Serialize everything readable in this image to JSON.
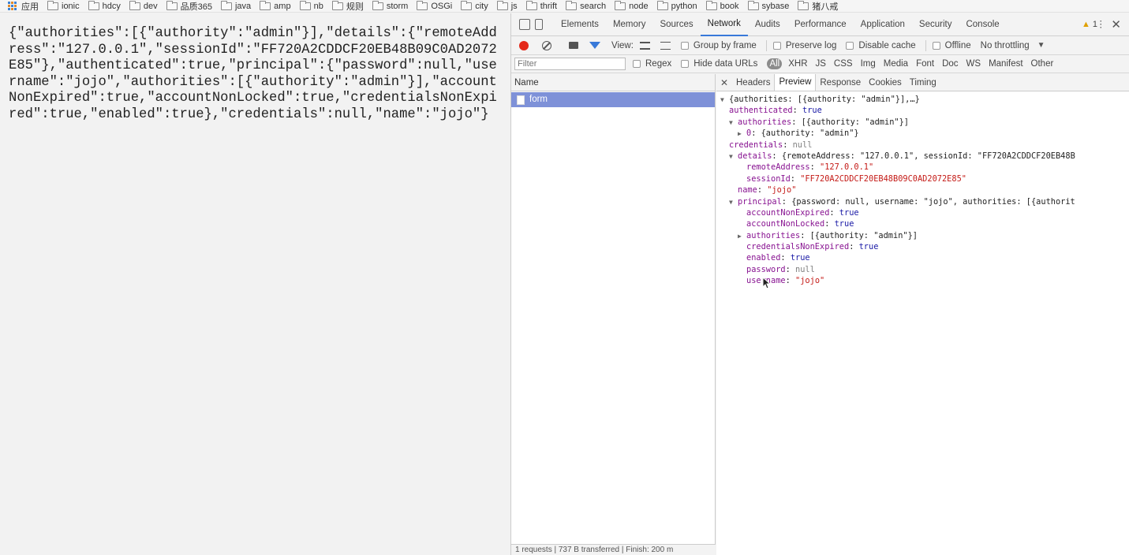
{
  "bookmarks": {
    "apps_label": "应用",
    "folders": [
      "ionic",
      "hdcy",
      "dev",
      "品质365",
      "java",
      "amp",
      "nb",
      "规则",
      "storm",
      "OSGi",
      "city",
      "js",
      "thrift",
      "search",
      "node",
      "python",
      "book",
      "sybase",
      "猪八戒"
    ]
  },
  "page": {
    "raw_json": "{\"authorities\":[{\"authority\":\"admin\"}],\"details\":{\"remoteAddress\":\"127.0.0.1\",\"sessionId\":\"FF720A2CDDCF20EB48B09C0AD2072E85\"},\"authenticated\":true,\"principal\":{\"password\":null,\"username\":\"jojo\",\"authorities\":[{\"authority\":\"admin\"}],\"accountNonExpired\":true,\"accountNonLocked\":true,\"credentialsNonExpired\":true,\"enabled\":true},\"credentials\":null,\"name\":\"jojo\"}"
  },
  "devtools": {
    "tabs": [
      "Elements",
      "Memory",
      "Sources",
      "Network",
      "Audits",
      "Performance",
      "Application",
      "Security",
      "Console"
    ],
    "active_tab": "Network",
    "warning_count": "1",
    "toolbar": {
      "view_label": "View:",
      "group_by_frame": "Group by frame",
      "preserve_log": "Preserve log",
      "disable_cache": "Disable cache",
      "offline": "Offline",
      "throttling": "No throttling"
    },
    "filter": {
      "placeholder": "Filter",
      "regex": "Regex",
      "hide_data_urls": "Hide data URLs",
      "types": [
        "All",
        "XHR",
        "JS",
        "CSS",
        "Img",
        "Media",
        "Font",
        "Doc",
        "WS",
        "Manifest",
        "Other"
      ]
    },
    "requests": {
      "column_name": "Name",
      "rows": [
        "form"
      ],
      "status": "1 requests | 737 B transferred | Finish: 200 m"
    },
    "detail_tabs": [
      "Headers",
      "Preview",
      "Response",
      "Cookies",
      "Timing"
    ],
    "active_detail_tab": "Preview",
    "preview": {
      "root_summary": "{authorities: [{authority: \"admin\"}],…}",
      "authenticated_key": "authenticated",
      "authenticated_val": "true",
      "authorities_key": "authorities",
      "authorities_summary": "[{authority: \"admin\"}]",
      "auth0_key": "0",
      "auth0_summary": "{authority: \"admin\"}",
      "credentials_key": "credentials",
      "credentials_val": "null",
      "details_key": "details",
      "details_summary": "{remoteAddress: \"127.0.0.1\", sessionId: \"FF720A2CDDCF20EB48B",
      "remote_key": "remoteAddress",
      "remote_val": "\"127.0.0.1\"",
      "session_key": "sessionId",
      "session_val": "\"FF720A2CDDCF20EB48B09C0AD2072E85\"",
      "name_key": "name",
      "name_val": "\"jojo\"",
      "principal_key": "principal",
      "principal_summary": "{password: null, username: \"jojo\", authorities: [{authorit",
      "ane_key": "accountNonExpired",
      "ane_val": "true",
      "anl_key": "accountNonLocked",
      "anl_val": "true",
      "p_auth_key": "authorities",
      "p_auth_summary": "[{authority: \"admin\"}]",
      "cne_key": "credentialsNonExpired",
      "cne_val": "true",
      "enabled_key": "enabled",
      "enabled_val": "true",
      "password_key": "password",
      "password_val": "null",
      "username_key": "username",
      "username_val": "\"jojo\""
    }
  }
}
